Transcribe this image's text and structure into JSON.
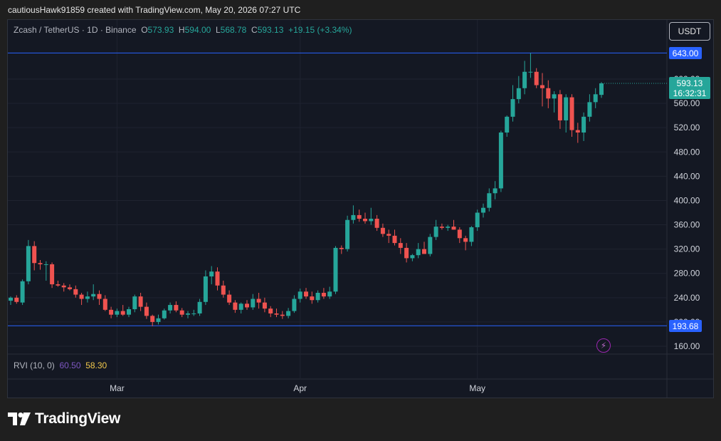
{
  "caption": "cautiousHawk91859 created with TradingView.com, May 20, 2026 07:27 UTC",
  "legend": {
    "symbol": "Zcash / TetherUS · 1D · Binance",
    "o_label": "O",
    "o": "573.93",
    "h_label": "H",
    "h": "594.00",
    "l_label": "L",
    "l": "568.78",
    "c_label": "C",
    "c": "593.13",
    "change": "+19.15 (+3.34%)"
  },
  "currency_button": "USDT",
  "indicator": {
    "name": "RVI (10, 0)",
    "value1": "60.50",
    "value2": "58.30"
  },
  "price_tags": {
    "high_line": "643.00",
    "low_line": "193.68",
    "last_price": "593.13",
    "countdown": "16:32:31"
  },
  "logo_text": "TradingView",
  "colors": {
    "up": "#26a69a",
    "down": "#ef5350",
    "line": "#2962ff",
    "background": "#141823"
  },
  "chart_data": {
    "type": "candlestick",
    "y_ticks": [
      "160.00",
      "200.00",
      "240.00",
      "280.00",
      "320.00",
      "360.00",
      "400.00",
      "440.00",
      "480.00",
      "520.00",
      "560.00",
      "600.00"
    ],
    "ylim": [
      140,
      665
    ],
    "x_ticks": [
      {
        "label": "Mar",
        "index": 18
      },
      {
        "label": "Apr",
        "index": 49
      },
      {
        "label": "May",
        "index": 79
      }
    ],
    "hlines": [
      643.0,
      193.68
    ],
    "candles": [
      [
        235,
        242,
        228,
        240
      ],
      [
        240,
        244,
        230,
        233
      ],
      [
        232,
        270,
        228,
        267
      ],
      [
        267,
        335,
        262,
        325
      ],
      [
        325,
        333,
        285,
        297
      ],
      [
        297,
        302,
        286,
        295
      ],
      [
        295,
        300,
        268,
        295
      ],
      [
        295,
        298,
        256,
        262
      ],
      [
        262,
        268,
        258,
        260
      ],
      [
        260,
        264,
        250,
        257
      ],
      [
        257,
        262,
        252,
        254
      ],
      [
        254,
        260,
        240,
        245
      ],
      [
        245,
        248,
        228,
        238
      ],
      [
        238,
        250,
        232,
        242
      ],
      [
        242,
        262,
        236,
        246
      ],
      [
        246,
        252,
        228,
        238
      ],
      [
        238,
        244,
        218,
        220
      ],
      [
        220,
        225,
        206,
        212
      ],
      [
        212,
        222,
        208,
        218
      ],
      [
        218,
        228,
        210,
        212
      ],
      [
        212,
        225,
        208,
        221
      ],
      [
        221,
        245,
        216,
        242
      ],
      [
        242,
        248,
        218,
        225
      ],
      [
        225,
        232,
        205,
        210
      ],
      [
        210,
        212,
        193,
        200
      ],
      [
        200,
        212,
        196,
        206
      ],
      [
        206,
        222,
        204,
        219
      ],
      [
        219,
        232,
        214,
        228
      ],
      [
        228,
        234,
        216,
        219
      ],
      [
        219,
        223,
        208,
        212
      ],
      [
        212,
        218,
        206,
        214
      ],
      [
        214,
        220,
        210,
        214
      ],
      [
        214,
        238,
        210,
        233
      ],
      [
        233,
        285,
        228,
        275
      ],
      [
        275,
        292,
        262,
        283
      ],
      [
        283,
        290,
        252,
        260
      ],
      [
        260,
        268,
        240,
        245
      ],
      [
        245,
        252,
        228,
        232
      ],
      [
        232,
        236,
        215,
        220
      ],
      [
        220,
        232,
        214,
        230
      ],
      [
        230,
        236,
        220,
        224
      ],
      [
        224,
        246,
        220,
        238
      ],
      [
        238,
        248,
        222,
        232
      ],
      [
        232,
        240,
        216,
        222
      ],
      [
        222,
        226,
        208,
        214
      ],
      [
        214,
        222,
        208,
        212
      ],
      [
        212,
        218,
        205,
        210
      ],
      [
        210,
        223,
        206,
        218
      ],
      [
        218,
        244,
        215,
        238
      ],
      [
        238,
        255,
        232,
        250
      ],
      [
        250,
        256,
        238,
        242
      ],
      [
        242,
        250,
        230,
        236
      ],
      [
        236,
        252,
        232,
        248
      ],
      [
        248,
        256,
        238,
        242
      ],
      [
        242,
        258,
        238,
        250
      ],
      [
        250,
        325,
        246,
        322
      ],
      [
        322,
        326,
        312,
        320
      ],
      [
        320,
        375,
        316,
        368
      ],
      [
        368,
        392,
        362,
        376
      ],
      [
        376,
        385,
        365,
        370
      ],
      [
        370,
        380,
        362,
        366
      ],
      [
        366,
        388,
        360,
        370
      ],
      [
        370,
        376,
        350,
        355
      ],
      [
        355,
        362,
        340,
        345
      ],
      [
        345,
        352,
        330,
        342
      ],
      [
        342,
        352,
        326,
        330
      ],
      [
        330,
        338,
        312,
        322
      ],
      [
        322,
        330,
        298,
        305
      ],
      [
        305,
        312,
        300,
        310
      ],
      [
        310,
        330,
        305,
        320
      ],
      [
        320,
        332,
        312,
        312
      ],
      [
        312,
        345,
        308,
        340
      ],
      [
        340,
        368,
        335,
        357
      ],
      [
        357,
        362,
        352,
        355
      ],
      [
        355,
        360,
        350,
        357
      ],
      [
        357,
        368,
        352,
        352
      ],
      [
        352,
        356,
        330,
        338
      ],
      [
        338,
        342,
        318,
        332
      ],
      [
        332,
        358,
        325,
        356
      ],
      [
        356,
        385,
        350,
        380
      ],
      [
        380,
        395,
        372,
        388
      ],
      [
        388,
        420,
        382,
        412
      ],
      [
        412,
        432,
        402,
        420
      ],
      [
        420,
        515,
        414,
        512
      ],
      [
        512,
        540,
        505,
        538
      ],
      [
        538,
        590,
        530,
        567
      ],
      [
        567,
        605,
        560,
        585
      ],
      [
        585,
        630,
        575,
        612
      ],
      [
        612,
        643,
        602,
        612
      ],
      [
        612,
        618,
        585,
        590
      ],
      [
        590,
        610,
        555,
        585
      ],
      [
        585,
        598,
        552,
        568
      ],
      [
        568,
        580,
        545,
        575
      ],
      [
        575,
        582,
        518,
        532
      ],
      [
        532,
        575,
        512,
        570
      ],
      [
        570,
        575,
        505,
        516
      ],
      [
        516,
        528,
        495,
        512
      ],
      [
        512,
        545,
        498,
        538
      ],
      [
        538,
        575,
        530,
        562
      ],
      [
        562,
        585,
        552,
        575
      ],
      [
        574,
        595,
        569,
        593
      ]
    ]
  }
}
